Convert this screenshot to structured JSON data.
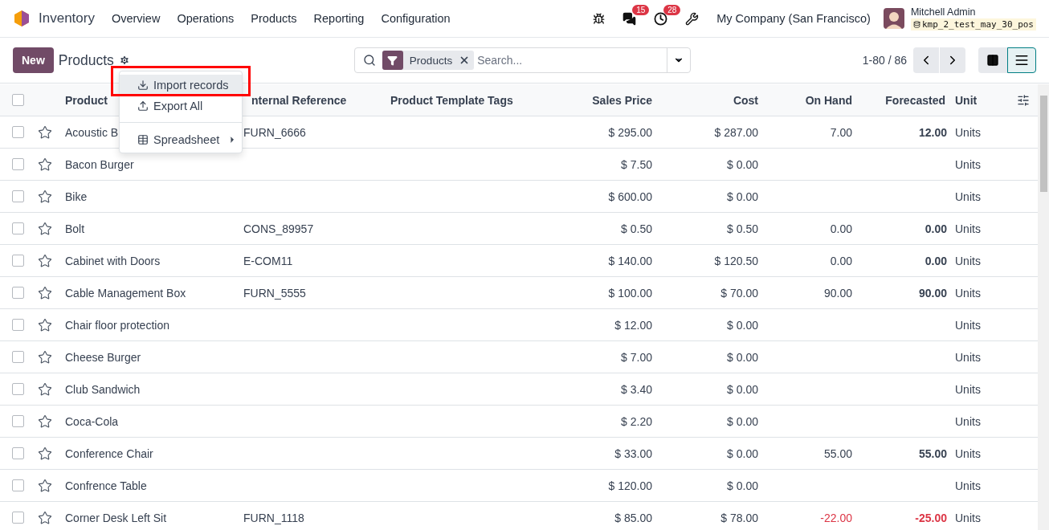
{
  "navbar": {
    "app": "Inventory",
    "menu": [
      "Overview",
      "Operations",
      "Products",
      "Reporting",
      "Configuration"
    ],
    "messages_badge": "15",
    "activities_badge": "28",
    "company": "My Company (San Francisco)",
    "user": "Mitchell Admin",
    "database": "kmp_2_test_may_30_pos"
  },
  "control_panel": {
    "new_button": "New",
    "title": "Products",
    "search": {
      "facet": "Products",
      "placeholder": "Search..."
    },
    "pager": "1-80 / 86",
    "views": [
      {
        "kind": "kanban",
        "selected": false
      },
      {
        "kind": "list",
        "selected": true
      }
    ]
  },
  "action_menu": {
    "items": [
      {
        "kind": "import",
        "label": "Import records",
        "highlighted": true
      },
      {
        "kind": "export",
        "label": "Export All",
        "highlighted": false
      },
      {
        "kind": "divider"
      },
      {
        "kind": "spreadsheet",
        "label": "Spreadsheet",
        "highlighted": false
      }
    ]
  },
  "table": {
    "select_all": {
      "checked": false
    },
    "columns": [
      "Product",
      "nternal Reference",
      "Product Template Tags",
      "Sales Price",
      "Cost",
      "On Hand",
      "Forecasted",
      "Unit"
    ],
    "rows": [
      {
        "checked": false,
        "starred": false,
        "name": "Acoustic B",
        "reference": "FURN_6666",
        "sales_price": "$ 295.00",
        "cost": "$ 287.00",
        "stock": {
          "on_hand": "7.00",
          "forecasted": "12.00",
          "negative": false
        },
        "unit": "Units"
      },
      {
        "checked": false,
        "starred": false,
        "name": "Bacon Burger",
        "sales_price": "$ 7.50",
        "cost": "$ 0.00",
        "unit": "Units"
      },
      {
        "checked": false,
        "starred": false,
        "name": "Bike",
        "sales_price": "$ 600.00",
        "cost": "$ 0.00",
        "unit": "Units"
      },
      {
        "checked": false,
        "starred": false,
        "name": "Bolt",
        "reference": "CONS_89957",
        "sales_price": "$ 0.50",
        "cost": "$ 0.50",
        "stock": {
          "on_hand": "0.00",
          "forecasted": "0.00",
          "negative": false
        },
        "unit": "Units"
      },
      {
        "checked": false,
        "starred": false,
        "name": "Cabinet with Doors",
        "reference": "E-COM11",
        "sales_price": "$ 140.00",
        "cost": "$ 120.50",
        "stock": {
          "on_hand": "0.00",
          "forecasted": "0.00",
          "negative": false
        },
        "unit": "Units"
      },
      {
        "checked": false,
        "starred": false,
        "name": "Cable Management Box",
        "reference": "FURN_5555",
        "sales_price": "$ 100.00",
        "cost": "$ 70.00",
        "stock": {
          "on_hand": "90.00",
          "forecasted": "90.00",
          "negative": false
        },
        "unit": "Units"
      },
      {
        "checked": false,
        "starred": false,
        "name": "Chair floor protection",
        "sales_price": "$ 12.00",
        "cost": "$ 0.00",
        "unit": "Units"
      },
      {
        "checked": false,
        "starred": false,
        "name": "Cheese Burger",
        "sales_price": "$ 7.00",
        "cost": "$ 0.00",
        "unit": "Units"
      },
      {
        "checked": false,
        "starred": false,
        "name": "Club Sandwich",
        "sales_price": "$ 3.40",
        "cost": "$ 0.00",
        "unit": "Units"
      },
      {
        "checked": false,
        "starred": false,
        "name": "Coca-Cola",
        "sales_price": "$ 2.20",
        "cost": "$ 0.00",
        "unit": "Units"
      },
      {
        "checked": false,
        "starred": false,
        "name": "Conference Chair",
        "sales_price": "$ 33.00",
        "cost": "$ 0.00",
        "stock": {
          "on_hand": "55.00",
          "forecasted": "55.00",
          "negative": false
        },
        "unit": "Units"
      },
      {
        "checked": false,
        "starred": false,
        "name": "Confrence Table",
        "sales_price": "$ 120.00",
        "cost": "$ 0.00",
        "unit": "Units"
      },
      {
        "checked": false,
        "starred": false,
        "name": "Corner Desk Left Sit",
        "reference": "FURN_1118",
        "sales_price": "$ 85.00",
        "cost": "$ 78.00",
        "stock": {
          "on_hand": "-22.00",
          "forecasted": "-25.00",
          "negative": true
        },
        "unit": "Units"
      }
    ]
  }
}
